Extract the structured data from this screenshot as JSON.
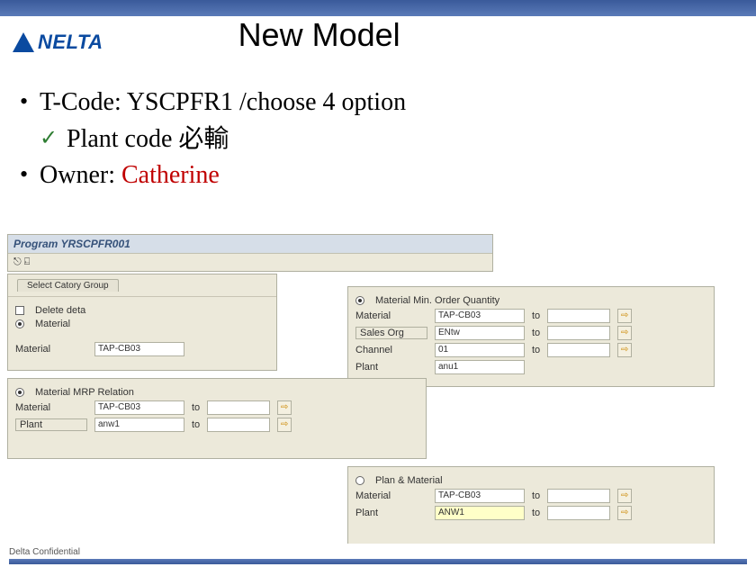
{
  "slide": {
    "title": "New Model",
    "bullet1_prefix": "T-Code: ",
    "bullet1_code": "YSCPFR1 /choose 4 option",
    "sub1": "Plant code 必輸",
    "bullet2_prefix": "Owner: ",
    "bullet2_owner": "Catherine"
  },
  "logo": {
    "text": "NELTA"
  },
  "sap": {
    "program_title": "Program YRSCPFR001",
    "toolbar_glyphs": "⎋ ⍇",
    "left": {
      "tab": "Select Catory Group",
      "delete_label": "Delete deta",
      "material_radio_label": "Material",
      "material_field_label": "Material",
      "material_value": "TAP-CB03"
    },
    "right": {
      "radio_label": "Material Min. Order Quantity",
      "rows": [
        {
          "label": "Material",
          "v1": "TAP-CB03",
          "to": "to"
        },
        {
          "label": "Sales Org",
          "boxed": true,
          "v1": "ENtw",
          "to": "to"
        },
        {
          "label": "Channel",
          "v1": "01",
          "to": "to"
        },
        {
          "label": "Plant",
          "v1": "anu1"
        }
      ]
    },
    "mid": {
      "radio_label": "Material MRP Relation",
      "rows": [
        {
          "label": "Material",
          "v1": "TAP-CB03",
          "to": "to"
        },
        {
          "label": "Plant",
          "boxed": true,
          "v1": "anw1",
          "to": "to"
        }
      ]
    },
    "bottom": {
      "radio_label": "Plan & Material",
      "rows": [
        {
          "label": "Material",
          "v1": "TAP-CB03",
          "to": "to"
        },
        {
          "label": "Plant",
          "v1": "ANW1",
          "to": "to"
        }
      ]
    }
  },
  "footer": "Delta Confidential"
}
